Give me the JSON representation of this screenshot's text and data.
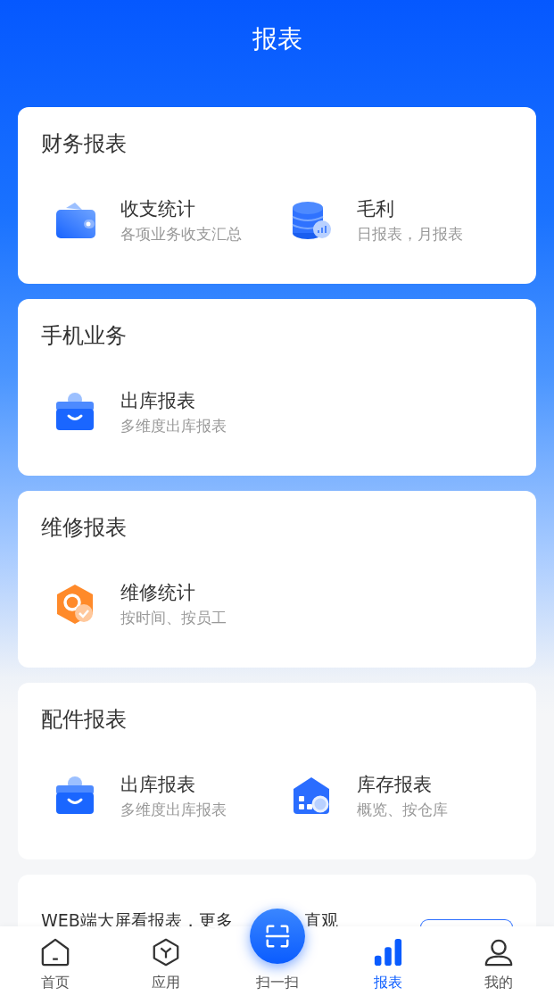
{
  "header": {
    "title": "报表"
  },
  "sections": [
    {
      "title": "财务报表",
      "items": [
        {
          "kind": "wallet",
          "title": "收支统计",
          "subtitle": "各项业务收支汇总"
        },
        {
          "kind": "coins",
          "title": "毛利",
          "subtitle": "日报表，月报表"
        }
      ]
    },
    {
      "title": "手机业务",
      "items": [
        {
          "kind": "box",
          "title": "出库报表",
          "subtitle": "多维度出库报表"
        }
      ]
    },
    {
      "title": "维修报表",
      "items": [
        {
          "kind": "repair",
          "title": "维修统计",
          "subtitle": "按时间、按员工"
        }
      ]
    },
    {
      "title": "配件报表",
      "items": [
        {
          "kind": "box",
          "title": "出库报表",
          "subtitle": "多维度出库报表"
        },
        {
          "kind": "warehouse",
          "title": "库存报表",
          "subtitle": "概览、按仓库"
        }
      ]
    }
  ],
  "promo": {
    "text": "WEB端大屏看报表，更多",
    "text_after": "直观"
  },
  "nav": [
    {
      "kind": "home",
      "label": "首页",
      "selected": false
    },
    {
      "kind": "cube",
      "label": "应用",
      "selected": false
    },
    {
      "kind": "scan",
      "label": "扫一扫",
      "selected": false
    },
    {
      "kind": "bars",
      "label": "报表",
      "selected": true
    },
    {
      "kind": "user",
      "label": "我的",
      "selected": false
    }
  ]
}
